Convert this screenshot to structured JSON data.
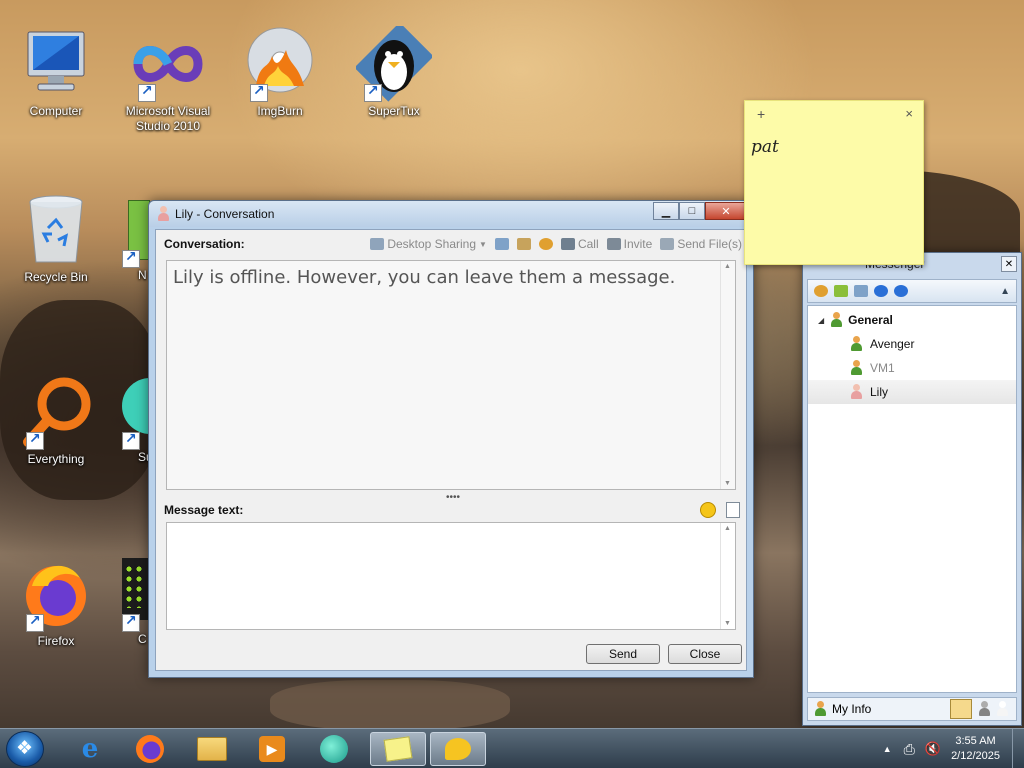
{
  "desktop": {
    "icons": [
      {
        "label": "Computer"
      },
      {
        "label": "Microsoft Visual Studio 2010"
      },
      {
        "label": "ImgBurn"
      },
      {
        "label": "SuperTux"
      },
      {
        "label": "Recycle Bin"
      },
      {
        "label": "N"
      },
      {
        "label": "Everything"
      },
      {
        "label": "Su"
      },
      {
        "label": "Firefox"
      },
      {
        "label": "C"
      }
    ]
  },
  "conversation": {
    "title": "Lily - Conversation",
    "conversation_label": "Conversation:",
    "tools": {
      "desktop_sharing": "Desktop Sharing",
      "call": "Call",
      "invite": "Invite",
      "send_files": "Send File(s)"
    },
    "offline_message": "Lily is offline. However, you can leave them a message.",
    "message_label": "Message text:",
    "message_value": "",
    "send_label": "Send",
    "close_label": "Close"
  },
  "sticky_note": {
    "plus": "+",
    "close": "×",
    "text": "pat"
  },
  "messenger": {
    "title": "Messenger",
    "group": "General",
    "contacts": [
      {
        "name": "Avenger",
        "status": "online"
      },
      {
        "name": "VM1",
        "status": "away"
      },
      {
        "name": "Lily",
        "status": "offline"
      }
    ],
    "my_info": "My Info"
  },
  "taskbar": {
    "time": "3:55 AM",
    "date": "2/12/2025"
  },
  "colors": {
    "accent": "#1a5ba8",
    "sticky": "#fdfba8",
    "window_frame": "#b9d1ea"
  }
}
